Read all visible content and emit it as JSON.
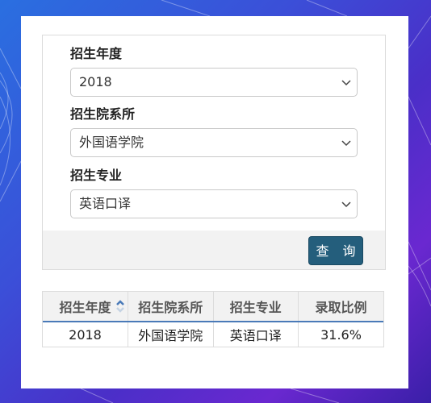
{
  "form": {
    "year": {
      "label": "招生年度",
      "value": "2018"
    },
    "department": {
      "label": "招生院系所",
      "value": "外国语学院"
    },
    "major": {
      "label": "招生专业",
      "value": "英语口译"
    },
    "query_button": "查 询"
  },
  "table": {
    "headers": [
      "招生年度",
      "招生院系所",
      "招生专业",
      "录取比例"
    ],
    "rows": [
      [
        "2018",
        "外国语学院",
        "英语口译",
        "31.6%"
      ]
    ]
  },
  "colors": {
    "button": "#245e7c",
    "header_underline": "#4a7ab8",
    "sort_icon": "#4a7ab8"
  },
  "icons": [
    "chevron-down-icon",
    "sort-icon"
  ]
}
